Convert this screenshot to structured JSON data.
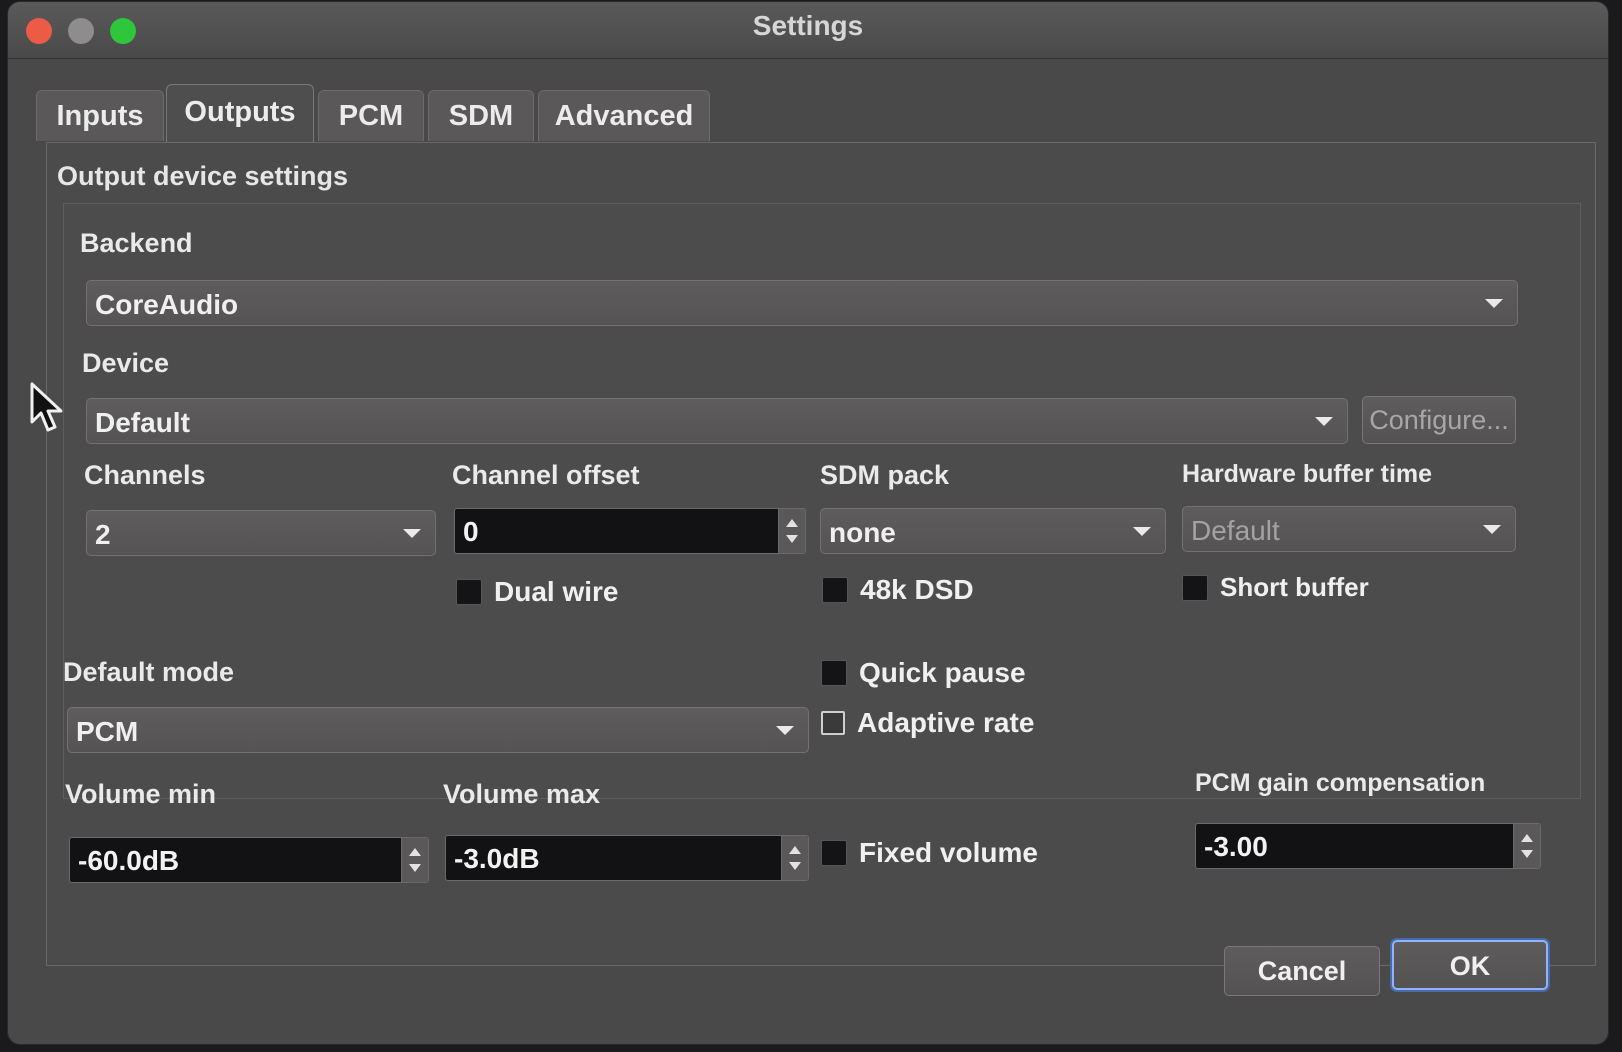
{
  "window": {
    "title": "Settings"
  },
  "tabs": [
    {
      "label": "Inputs",
      "active": false
    },
    {
      "label": "Outputs",
      "active": true
    },
    {
      "label": "PCM",
      "active": false
    },
    {
      "label": "SDM",
      "active": false
    },
    {
      "label": "Advanced",
      "active": false
    }
  ],
  "outputs": {
    "section_title": "Output device settings",
    "backend": {
      "label": "Backend",
      "value": "CoreAudio"
    },
    "device": {
      "label": "Device",
      "value": "Default",
      "configure_label": "Configure..."
    },
    "channels": {
      "label": "Channels",
      "value": "2"
    },
    "channel_offset": {
      "label": "Channel offset",
      "value": "0"
    },
    "sdm_pack": {
      "label": "SDM pack",
      "value": "none"
    },
    "hw_buffer": {
      "label": "Hardware buffer time",
      "value": "Default"
    },
    "dual_wire": {
      "label": "Dual wire",
      "checked": false
    },
    "dsd48k": {
      "label": "48k DSD",
      "checked": false
    },
    "short_buffer": {
      "label": "Short buffer",
      "checked": false
    },
    "default_mode": {
      "label": "Default mode",
      "value": "PCM"
    },
    "quick_pause": {
      "label": "Quick pause",
      "checked": false
    },
    "adaptive_rate": {
      "label": "Adaptive rate",
      "checked": false
    },
    "volume_min": {
      "label": "Volume min",
      "value": "-60.0dB"
    },
    "volume_max": {
      "label": "Volume max",
      "value": "-3.0dB"
    },
    "fixed_volume": {
      "label": "Fixed volume",
      "checked": false
    },
    "pcm_gain": {
      "label": "PCM gain compensation",
      "value": "-3.00"
    }
  },
  "buttons": {
    "cancel": "Cancel",
    "ok": "OK"
  }
}
